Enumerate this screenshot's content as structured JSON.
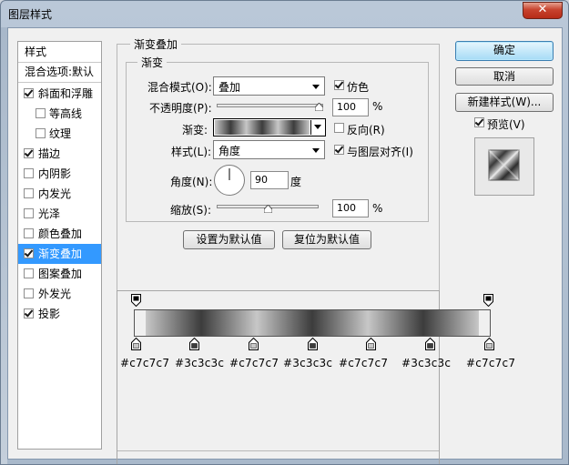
{
  "window": {
    "title": "图层样式",
    "close": "✕"
  },
  "styles": {
    "header": "样式",
    "blend_options": "混合选项:默认",
    "items": [
      {
        "label": "斜面和浮雕",
        "checked": true
      },
      {
        "label": "等高线",
        "checked": false
      },
      {
        "label": "纹理",
        "checked": false
      },
      {
        "label": "描边",
        "checked": true
      },
      {
        "label": "内阴影",
        "checked": false
      },
      {
        "label": "内发光",
        "checked": false
      },
      {
        "label": "光泽",
        "checked": false
      },
      {
        "label": "颜色叠加",
        "checked": false
      },
      {
        "label": "渐变叠加",
        "checked": true,
        "selected": true
      },
      {
        "label": "图案叠加",
        "checked": false
      },
      {
        "label": "外发光",
        "checked": false
      },
      {
        "label": "投影",
        "checked": true
      }
    ]
  },
  "panel": {
    "group_title": "渐变叠加",
    "sub_title": "渐变",
    "blend_mode_label": "混合模式(O):",
    "blend_mode_value": "叠加",
    "dither_label": "仿色",
    "dither_checked": true,
    "opacity_label": "不透明度(P):",
    "opacity_value": "100",
    "opacity_unit": "%",
    "opacity_level": 1.0,
    "gradient_label": "渐变:",
    "reverse_label": "反向(R)",
    "reverse_checked": false,
    "style_label": "样式(L):",
    "style_value": "角度",
    "align_label": "与图层对齐(I)",
    "align_checked": true,
    "angle_label": "角度(N):",
    "angle_value": "90",
    "angle_unit": "度",
    "scale_label": "缩放(S):",
    "scale_value": "100",
    "scale_unit": "%",
    "scale_level": 0.5,
    "set_default": "设置为默认值",
    "reset_default": "复位为默认值"
  },
  "buttons": {
    "ok": "确定",
    "cancel": "取消",
    "new_style": "新建样式(W)...",
    "preview_label": "预览(V)",
    "preview_checked": true
  },
  "gradient_editor": {
    "colors": [
      "#c7c7c7",
      "#3c3c3c",
      "#c7c7c7",
      "#3c3c3c",
      "#c7c7c7",
      "#3c3c3c",
      "#c7c7c7"
    ],
    "labels": [
      "#c7c7c7",
      "#3c3c3c",
      "#c7c7c7",
      "#3c3c3c",
      "#c7c7c7",
      "#3c3c3c",
      "#c7c7c7"
    ]
  }
}
